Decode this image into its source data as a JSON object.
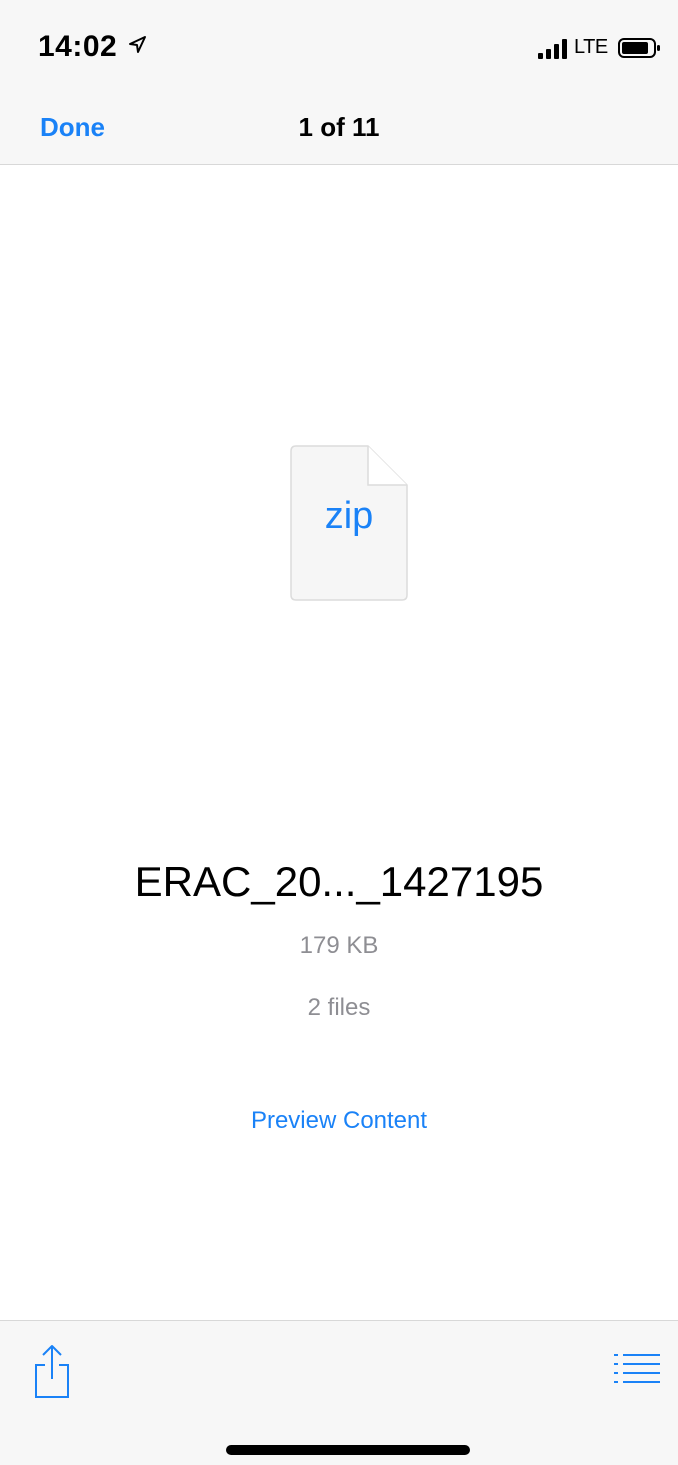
{
  "status_bar": {
    "time": "14:02",
    "network": "LTE",
    "icons": [
      "location-arrow-icon",
      "signal-icon",
      "battery-icon"
    ]
  },
  "nav": {
    "done_label": "Done",
    "title": "1 of 11"
  },
  "file": {
    "type_label": "zip",
    "name": "ERAC_20..._1427195",
    "size": "179 KB",
    "count": "2 files",
    "preview_label": "Preview Content",
    "icon": "zip-file-icon"
  },
  "toolbar": {
    "icons": [
      "share-icon",
      "list-icon"
    ]
  },
  "colors": {
    "accent": "#1a82f7",
    "secondary_text": "#8e8e93",
    "bar_background": "#f7f7f7"
  }
}
